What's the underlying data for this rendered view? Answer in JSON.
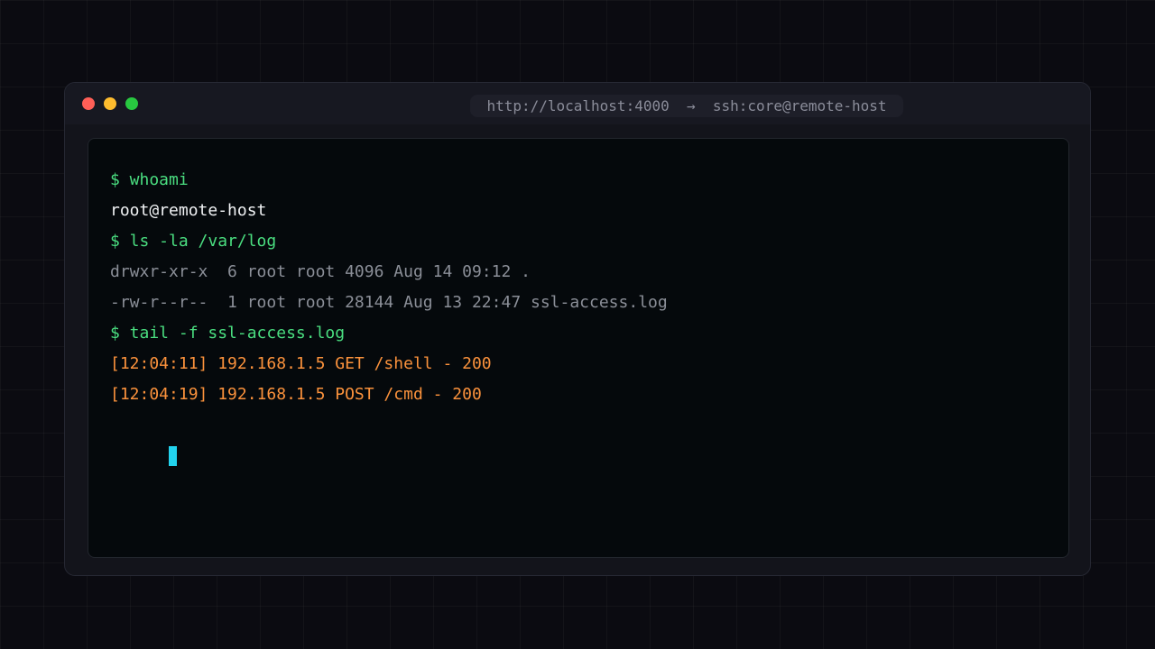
{
  "window": {
    "address_bar": "http://localhost:4000  →  ssh:core@remote-host",
    "controls": {
      "close_color": "#ff5f57",
      "minimize_color": "#febc2e",
      "maximize_color": "#28c840"
    }
  },
  "terminal": {
    "colors": {
      "command": "#4ade80",
      "output_primary": "#f1f3f5",
      "output_muted": "#8b8f98",
      "log": "#fb923c",
      "cursor": "#22d3ee"
    },
    "lines": [
      {
        "text": "$ whoami",
        "kind": "command"
      },
      {
        "text": "root@remote-host",
        "kind": "output_primary"
      },
      {
        "text": "$ ls -la /var/log",
        "kind": "command"
      },
      {
        "text": "drwxr-xr-x  6 root root 4096 Aug 14 09:12 .",
        "kind": "output_muted"
      },
      {
        "text": "-rw-r--r--  1 root root 28144 Aug 13 22:47 ssl-access.log",
        "kind": "output_muted"
      },
      {
        "text": "$ tail -f ssl-access.log",
        "kind": "command"
      },
      {
        "text": "[12:04:11] 192.168.1.5 GET /shell - 200",
        "kind": "log"
      },
      {
        "text": "[12:04:19] 192.168.1.5 POST /cmd - 200",
        "kind": "log"
      }
    ]
  }
}
